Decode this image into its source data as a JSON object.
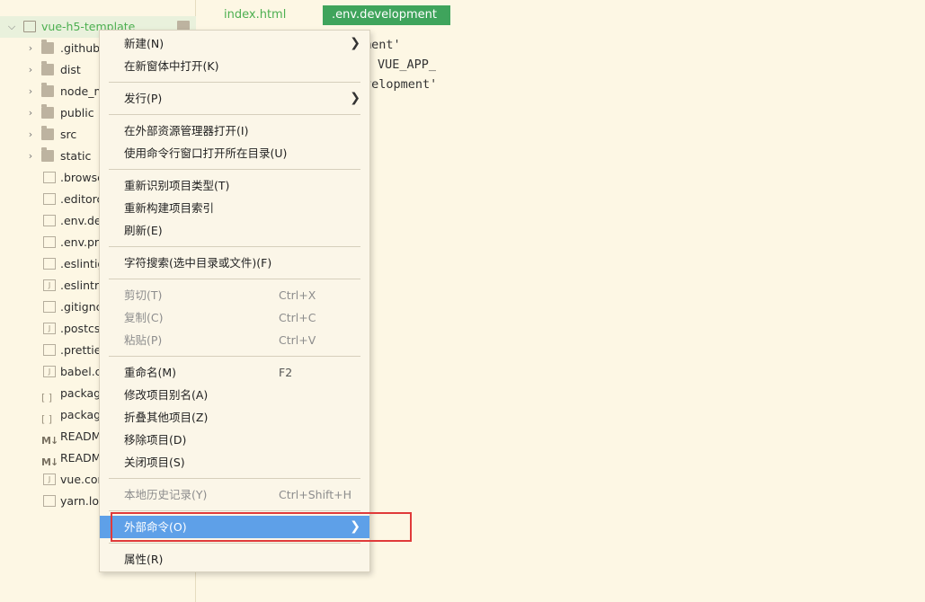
{
  "sidebar": {
    "root": "vue-h5-template",
    "items": [
      {
        "label": ".github",
        "type": "folder"
      },
      {
        "label": "dist",
        "type": "folder"
      },
      {
        "label": "node_m",
        "type": "folder"
      },
      {
        "label": "public",
        "type": "folder"
      },
      {
        "label": "src",
        "type": "folder"
      },
      {
        "label": "static",
        "type": "folder"
      },
      {
        "label": ".browse",
        "type": "file"
      },
      {
        "label": ".editorc",
        "type": "file"
      },
      {
        "label": ".env.dev",
        "type": "file"
      },
      {
        "label": ".env.pro",
        "type": "file"
      },
      {
        "label": ".eslintig",
        "type": "file"
      },
      {
        "label": ".eslintrc",
        "type": "js"
      },
      {
        "label": ".gitignc",
        "type": "file"
      },
      {
        "label": ".postcs",
        "type": "js"
      },
      {
        "label": ".prettie",
        "type": "file"
      },
      {
        "label": "babel.c",
        "type": "js"
      },
      {
        "label": "packag",
        "type": "json"
      },
      {
        "label": "packag",
        "type": "json"
      },
      {
        "label": "READM",
        "type": "md"
      },
      {
        "label": "READM",
        "type": "md"
      },
      {
        "label": "vue.cor",
        "type": "js"
      },
      {
        "label": "yarn.loc",
        "type": "file"
      }
    ]
  },
  "editor": {
    "tabs": [
      {
        "label": "index.html",
        "active": false
      },
      {
        "label": ".env.development",
        "active": true
      }
    ],
    "code_lines": [
      "ment'",
      "VUE_APP_",
      "velopment'"
    ]
  },
  "context_menu": {
    "groups": [
      [
        {
          "label": "新建(N)",
          "submenu": true
        },
        {
          "label": "在新窗体中打开(K)"
        }
      ],
      [
        {
          "label": "发行(P)",
          "submenu": true
        }
      ],
      [
        {
          "label": "在外部资源管理器打开(I)"
        },
        {
          "label": "使用命令行窗口打开所在目录(U)"
        }
      ],
      [
        {
          "label": "重新识别项目类型(T)"
        },
        {
          "label": "重新构建项目索引"
        },
        {
          "label": "刷新(E)"
        }
      ],
      [
        {
          "label": "字符搜索(选中目录或文件)(F)"
        }
      ],
      [
        {
          "label": "剪切(T)",
          "shortcut": "Ctrl+X",
          "disabled": true
        },
        {
          "label": "复制(C)",
          "shortcut": "Ctrl+C",
          "disabled": true
        },
        {
          "label": "粘贴(P)",
          "shortcut": "Ctrl+V",
          "disabled": true
        }
      ],
      [
        {
          "label": "重命名(M)",
          "shortcut": "F2"
        },
        {
          "label": "修改项目别名(A)"
        },
        {
          "label": "折叠其他项目(Z)"
        },
        {
          "label": "移除项目(D)"
        },
        {
          "label": "关闭项目(S)"
        }
      ],
      [
        {
          "label": "本地历史记录(Y)",
          "shortcut": "Ctrl+Shift+H",
          "disabled": true
        }
      ],
      [
        {
          "label": "外部命令(O)",
          "submenu": true,
          "highlighted": true
        }
      ],
      [
        {
          "label": "属性(R)"
        }
      ]
    ]
  },
  "colors": {
    "background": "#fdf7e4",
    "accent_green": "#3fa45c",
    "menu_highlight": "#5ea0e8",
    "annotation_red": "#e03a3a"
  }
}
